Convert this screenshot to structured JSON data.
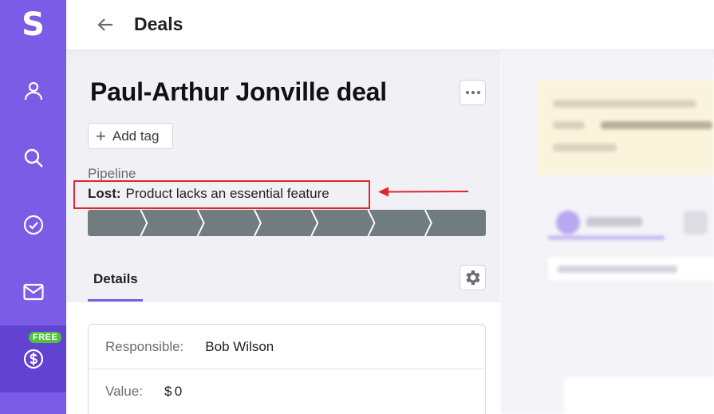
{
  "sidebar": {
    "logo": "S",
    "items": [
      {
        "icon": "person-icon"
      },
      {
        "icon": "search-icon"
      },
      {
        "icon": "check-circle-icon"
      },
      {
        "icon": "mail-icon"
      },
      {
        "icon": "dollar-circle-icon",
        "badge": "FREE",
        "active": true
      }
    ]
  },
  "header": {
    "title": "Deals"
  },
  "deal": {
    "title": "Paul-Arthur Jonville deal",
    "add_tag_label": "Add tag",
    "pipeline_label": "Pipeline",
    "lost_label": "Lost:",
    "lost_reason": "Product lacks an essential feature",
    "stage_count": 7
  },
  "tabs": {
    "details_label": "Details"
  },
  "details": {
    "responsible_label": "Responsible:",
    "responsible_value": "Bob Wilson",
    "value_label": "Value:",
    "value_value": "$ 0"
  },
  "colors": {
    "sidebar": "#7b5ce6",
    "sidebar_active": "#6242d0",
    "badge": "#4fc23a",
    "stage": "#717c81",
    "highlight": "#e0262a",
    "tab_underline": "#7b5ce6"
  }
}
